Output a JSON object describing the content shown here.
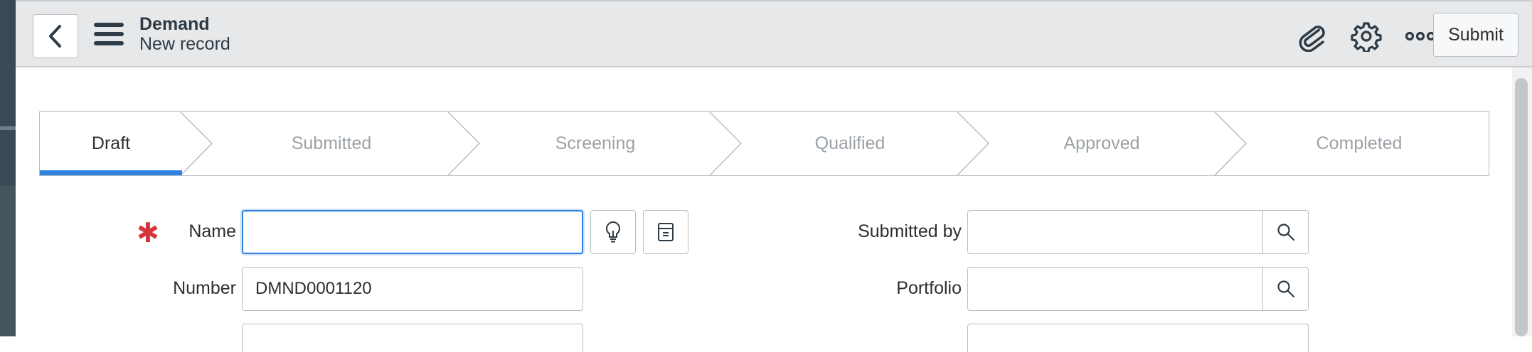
{
  "header": {
    "title": "Demand",
    "subtitle": "New record",
    "submit_label": "Submit",
    "icons": [
      "back-arrow-icon",
      "hamburger-menu-icon",
      "paperclip-icon",
      "gear-icon",
      "more-options-icon"
    ]
  },
  "process_flow": {
    "stages": [
      "Draft",
      "Submitted",
      "Screening",
      "Qualified",
      "Approved",
      "Completed"
    ],
    "active_index": 0
  },
  "form": {
    "name": {
      "label": "Name",
      "value": "",
      "required": true
    },
    "number": {
      "label": "Number",
      "value": "DMND0001120"
    },
    "submitted_by": {
      "label": "Submitted by",
      "value": ""
    },
    "portfolio": {
      "label": "Portfolio",
      "value": ""
    }
  },
  "colors": {
    "accent": "#2f82e0",
    "required": "#d4343a",
    "header_bg": "#e6e8ea",
    "shell": "#3a4a55"
  }
}
